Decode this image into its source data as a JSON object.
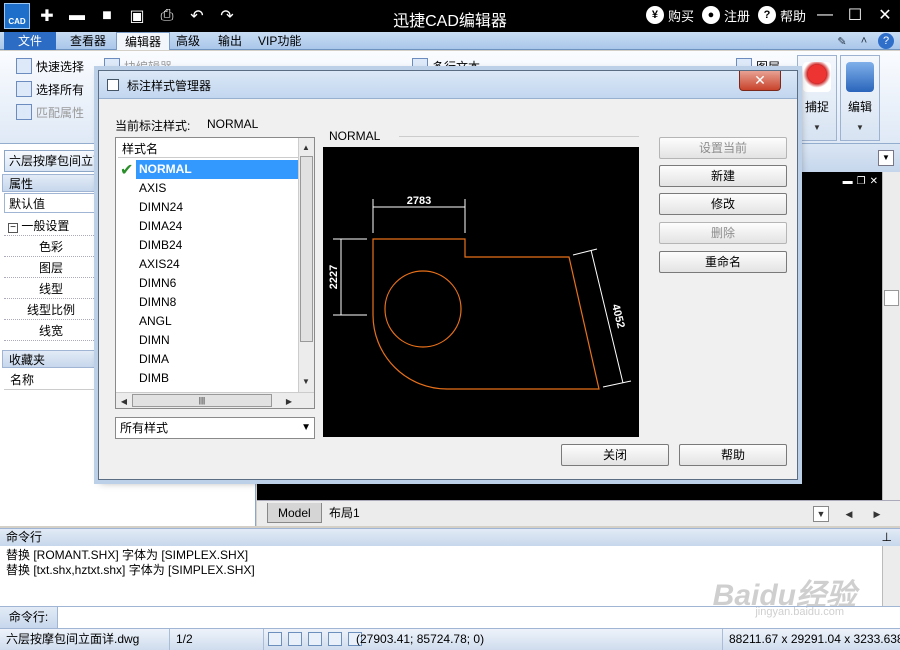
{
  "app": {
    "title": "迅捷CAD编辑器",
    "logo_text": "CAD",
    "buy_label": "购买",
    "register_label": "注册",
    "help_label": "帮助"
  },
  "menu": {
    "file": "文件",
    "tabs": [
      "查看器",
      "编辑器",
      "高级",
      "输出",
      "VIP功能"
    ],
    "active_tab": "编辑器"
  },
  "ribbon": {
    "quick_select": "快速选择",
    "select_all": "选择所有",
    "match_props": "匹配属性",
    "block_editor": "块编辑器",
    "multiline_text": "多行文本",
    "layer": "图层",
    "snap": "捕捉",
    "edit": "编辑"
  },
  "left_panel": {
    "doc_tab": "六层按摩包间立面详",
    "properties_header": "属性",
    "default_value": "默认值",
    "general_settings": "一般设置",
    "general_toggle": "−",
    "props": [
      "色彩",
      "图层",
      "线型",
      "线型比例",
      "线宽"
    ],
    "favorites_header": "收藏夹",
    "favorites_column": "名称"
  },
  "drawing": {
    "tabs": [
      "Model",
      "布局1"
    ]
  },
  "command": {
    "header": "命令行",
    "log": [
      "替换 [ROMANT.SHX] 字体为 [SIMPLEX.SHX]",
      "替换 [txt.shx,hztxt.shx] 字体为 [SIMPLEX.SHX]"
    ],
    "input_label": "命令行:",
    "input_value": ""
  },
  "watermark": {
    "main": "Baidu经验",
    "sub": "jingyan.baidu.com"
  },
  "status": {
    "filename": "六层按摩包间立面详.dwg",
    "page": "1/2",
    "cursor": "(27903.41; 85724.78; 0)",
    "extent": "88211.67 x 29291.04 x 3233.638"
  },
  "dialog": {
    "title": "标注样式管理器",
    "current_style_label": "当前标注样式:",
    "current_style": "NORMAL",
    "list_header": "样式名",
    "styles": [
      "NORMAL",
      "AXIS",
      "DIMN24",
      "DIMA24",
      "DIMB24",
      "AXIS24",
      "DIMN6",
      "DIMN8",
      "ANGL",
      "DIMN",
      "DIMA",
      "DIMB"
    ],
    "selected_style": "NORMAL",
    "filter_value": "所有样式",
    "preview_label": "NORMAL",
    "preview_dims": {
      "top": "2783",
      "left": "2227",
      "right": "4052"
    },
    "buttons": {
      "set_current": "设置当前",
      "new": "新建",
      "modify": "修改",
      "delete": "删除",
      "rename": "重命名",
      "close": "关闭",
      "help": "帮助"
    },
    "colors": {
      "preview_geometry": "#e8711a",
      "preview_dim": "#ffffff",
      "selection": "#3399ff"
    }
  }
}
